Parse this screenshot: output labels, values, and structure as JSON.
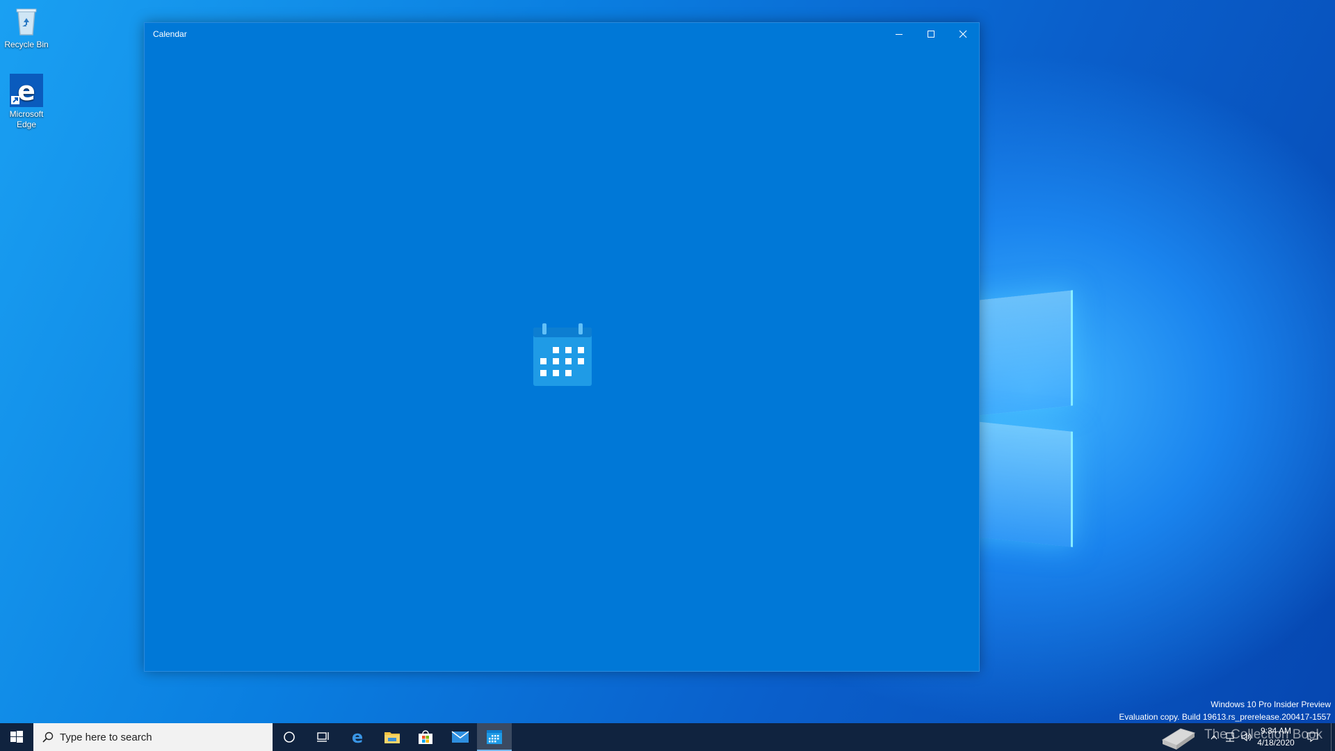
{
  "desktop": {
    "icons": [
      {
        "label": "Recycle Bin",
        "icon": "recycle-bin-icon"
      },
      {
        "label": "Microsoft Edge",
        "icon": "edge-icon"
      }
    ],
    "watermark": {
      "line1": "Windows 10 Pro Insider Preview",
      "line2": "Evaluation copy. Build 19613.rs_prerelease.200417-1557"
    },
    "logo_overlay_text": "The Collection Book"
  },
  "window": {
    "title": "Calendar",
    "minimize_icon": "minimize-icon",
    "maximize_icon": "maximize-icon",
    "close_icon": "close-icon",
    "splash_icon": "calendar-icon",
    "background_color": "#0078d7"
  },
  "taskbar": {
    "search_placeholder": "Type here to search",
    "pinned": [
      "start-icon",
      "cortana-icon",
      "task-view-icon",
      "edge-icon",
      "file-explorer-icon",
      "store-icon",
      "mail-icon",
      "calendar-icon"
    ],
    "active_app": "Calendar",
    "clock": {
      "time": "9:34 AM",
      "date": "4/18/2020"
    },
    "tray_icons": [
      "chevron-up-icon",
      "network-icon",
      "volume-icon",
      "notification-icon"
    ],
    "background_color": "#10233f"
  }
}
